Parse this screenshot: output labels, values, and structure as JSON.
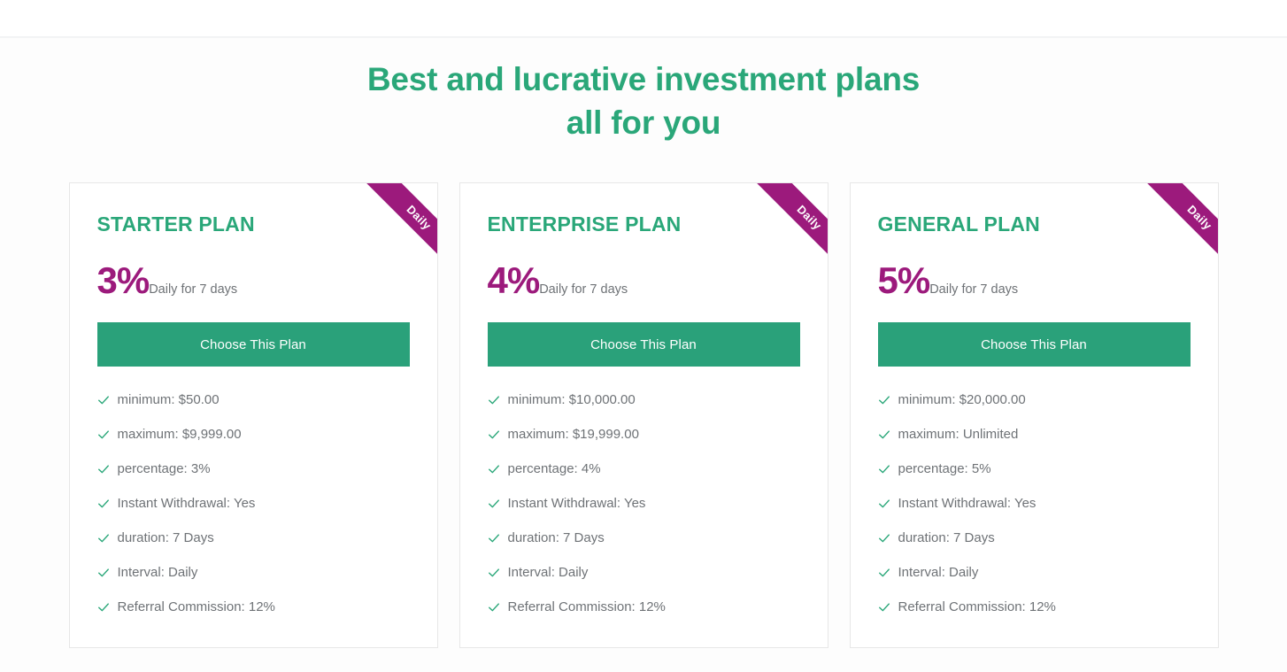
{
  "page": {
    "heading_line1": "Best and lucrative investment plans",
    "heading_line2": "all for you",
    "accent_green": "#2aa779",
    "accent_magenta": "#9c1a7c",
    "button_green": "#2aa17a",
    "text_gray": "#6e7276",
    "card_border": "#e7e7e7",
    "section_background": "#fdfdfd"
  },
  "plans": [
    {
      "title": "STARTER PLAN",
      "rate": "3%",
      "rate_caption": "Daily for 7 days",
      "ribbon_label": "Daily",
      "button_label": "Choose This Plan",
      "features": [
        "minimum: $50.00",
        "maximum: $9,999.00",
        "percentage: 3%",
        "Instant Withdrawal: Yes",
        "duration: 7 Days",
        "Interval: Daily",
        "Referral Commission: 12%"
      ]
    },
    {
      "title": "ENTERPRISE PLAN",
      "rate": "4%",
      "rate_caption": "Daily for 7 days",
      "ribbon_label": "Daily",
      "button_label": "Choose This Plan",
      "features": [
        "minimum: $10,000.00",
        "maximum: $19,999.00",
        "percentage: 4%",
        "Instant Withdrawal: Yes",
        "duration: 7 Days",
        "Interval: Daily",
        "Referral Commission: 12%"
      ]
    },
    {
      "title": "GENERAL PLAN",
      "rate": "5%",
      "rate_caption": "Daily for 7 days",
      "ribbon_label": "Daily",
      "button_label": "Choose This Plan",
      "features": [
        "minimum: $20,000.00",
        "maximum: Unlimited",
        "percentage: 5%",
        "Instant Withdrawal: Yes",
        "duration: 7 Days",
        "Interval: Daily",
        "Referral Commission: 12%"
      ]
    }
  ],
  "icons": {
    "check": "check-icon"
  }
}
